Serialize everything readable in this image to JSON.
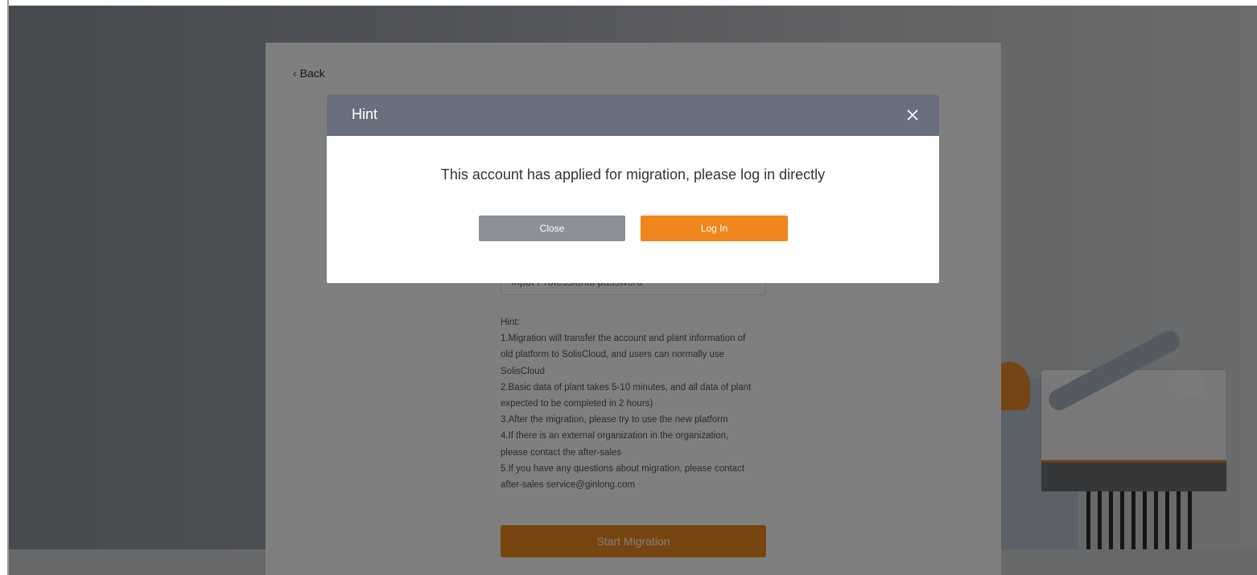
{
  "page": {
    "back_label": "Back",
    "password_placeholder": "Input Professional password",
    "hint_lines": [
      "Hint:",
      "1.Migration will transfer the account and plant information of",
      "old platform to SolisCloud, and users can normally use",
      "SolisCloud",
      "2.Basic data of plant takes 5-10 minutes, and all data of plant",
      "expected to be completed in 2 hours)",
      "3.After the migration, please try to use the new platform",
      "4.If there is an external organization in the organization,",
      "please contact the after-sales",
      "5.If you have any questions about migration, please contact",
      "after-sales service@ginlong.com"
    ],
    "start_button_label": "Start Migration"
  },
  "modal": {
    "title": "Hint",
    "close_icon": "close-icon",
    "message": "This account has applied for migration, please log in directly",
    "close_button_label": "Close",
    "login_button_label": "Log In"
  },
  "colors": {
    "accent": "#f0861c",
    "modal_header": "#6a6f7e",
    "secondary_button": "#8c8f96"
  }
}
